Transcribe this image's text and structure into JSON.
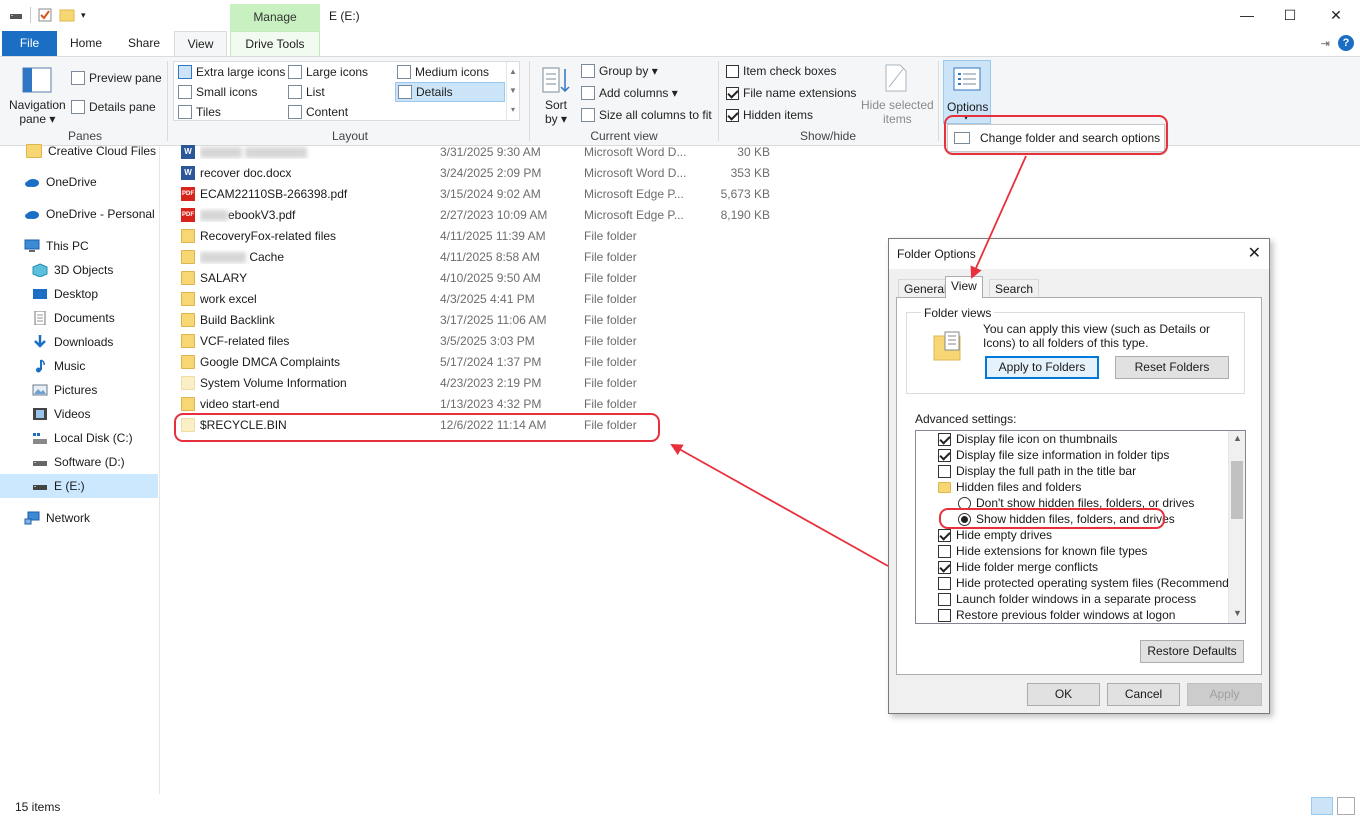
{
  "window": {
    "title": "E (E:)",
    "contextual_tab": "Manage",
    "minimize": "—",
    "maximize": "☐",
    "close": "✕"
  },
  "tabs": {
    "file": "File",
    "home": "Home",
    "share": "Share",
    "view": "View",
    "drive_tools": "Drive Tools"
  },
  "ribbon": {
    "panes": {
      "label": "Panes",
      "navigation_pane_line1": "Navigation",
      "navigation_pane_line2": "pane ▾",
      "preview_pane": "Preview pane",
      "details_pane": "Details pane"
    },
    "layout": {
      "label": "Layout",
      "items": [
        "Extra large icons",
        "Large icons",
        "Medium icons",
        "Small icons",
        "List",
        "Details",
        "Tiles",
        "Content"
      ],
      "selected": "Details"
    },
    "current_view": {
      "label": "Current view",
      "sort_line1": "Sort",
      "sort_line2": "by ▾",
      "group_by": "Group by ▾",
      "add_columns": "Add columns ▾",
      "size_columns": "Size all columns to fit"
    },
    "show_hide": {
      "label": "Show/hide",
      "item_check_boxes": "Item check boxes",
      "file_name_extensions": "File name extensions",
      "hidden_items": "Hidden items",
      "hide_selected_line1": "Hide selected",
      "hide_selected_line2": "items"
    },
    "options": {
      "label": "Options",
      "menu_item": "Change folder and search options"
    }
  },
  "nav": {
    "items": [
      {
        "label": "Creative Cloud Files F",
        "icon": "folder-icon"
      },
      {
        "label": "OneDrive",
        "icon": "cloud-icon"
      },
      {
        "label": "OneDrive - Personal",
        "icon": "cloud-icon"
      },
      {
        "label": "This PC",
        "icon": "computer-icon"
      },
      {
        "label": "3D Objects",
        "icon": "cube-icon"
      },
      {
        "label": "Desktop",
        "icon": "desktop-icon"
      },
      {
        "label": "Documents",
        "icon": "document-icon"
      },
      {
        "label": "Downloads",
        "icon": "download-icon"
      },
      {
        "label": "Music",
        "icon": "music-icon"
      },
      {
        "label": "Pictures",
        "icon": "picture-icon"
      },
      {
        "label": "Videos",
        "icon": "video-icon"
      },
      {
        "label": "Local Disk (C:)",
        "icon": "drive-icon"
      },
      {
        "label": "Software (D:)",
        "icon": "drive-icon"
      },
      {
        "label": "E (E:)",
        "icon": "drive-icon"
      },
      {
        "label": "Network",
        "icon": "network-icon"
      }
    ]
  },
  "files": [
    {
      "name": "",
      "date": "3/31/2025 9:30 AM",
      "type": "Microsoft Word D...",
      "size": "30 KB",
      "icon": "word-icon"
    },
    {
      "name": "recover doc.docx",
      "date": "3/24/2025 2:09 PM",
      "type": "Microsoft Word D...",
      "size": "353 KB",
      "icon": "word-icon"
    },
    {
      "name": "ECAM22110SB-266398.pdf",
      "date": "3/15/2024 9:02 AM",
      "type": "Microsoft Edge P...",
      "size": "5,673 KB",
      "icon": "pdf-icon"
    },
    {
      "name": "ebookV3.pdf",
      "date": "2/27/2023 10:09 AM",
      "type": "Microsoft Edge P...",
      "size": "8,190 KB",
      "icon": "pdf-icon"
    },
    {
      "name": "RecoveryFox-related files",
      "date": "4/11/2025 11:39 AM",
      "type": "File folder",
      "size": "",
      "icon": "folder-icon"
    },
    {
      "name": "Cache",
      "date": "4/11/2025 8:58 AM",
      "type": "File folder",
      "size": "",
      "icon": "folder-icon"
    },
    {
      "name": "SALARY",
      "date": "4/10/2025 9:50 AM",
      "type": "File folder",
      "size": "",
      "icon": "folder-icon"
    },
    {
      "name": "work excel",
      "date": "4/3/2025 4:41 PM",
      "type": "File folder",
      "size": "",
      "icon": "folder-icon"
    },
    {
      "name": "Build Backlink",
      "date": "3/17/2025 11:06 AM",
      "type": "File folder",
      "size": "",
      "icon": "folder-icon"
    },
    {
      "name": "VCF-related files",
      "date": "3/5/2025 3:03 PM",
      "type": "File folder",
      "size": "",
      "icon": "folder-icon"
    },
    {
      "name": "Google DMCA Complaints",
      "date": "5/17/2024 1:37 PM",
      "type": "File folder",
      "size": "",
      "icon": "folder-icon"
    },
    {
      "name": "System Volume Information",
      "date": "4/23/2023 2:19 PM",
      "type": "File folder",
      "size": "",
      "icon": "folder-icon"
    },
    {
      "name": "video start-end",
      "date": "1/13/2023 4:32 PM",
      "type": "File folder",
      "size": "",
      "icon": "folder-icon"
    },
    {
      "name": "$RECYCLE.BIN",
      "date": "12/6/2022 11:14 AM",
      "type": "File folder",
      "size": "",
      "icon": "folder-icon"
    }
  ],
  "status": {
    "items_count": "15 items"
  },
  "dialog": {
    "title": "Folder Options",
    "tabs": [
      "General",
      "View",
      "Search"
    ],
    "active_tab": "View",
    "folder_views": {
      "legend": "Folder views",
      "description": "You can apply this view (such as Details or Icons) to all folders of this type.",
      "apply_button": "Apply to Folders",
      "reset_button": "Reset Folders"
    },
    "advanced_label": "Advanced settings:",
    "advanced_items": [
      {
        "label": "Display file icon on thumbnails",
        "kind": "checkbox",
        "checked": true
      },
      {
        "label": "Display file size information in folder tips",
        "kind": "checkbox",
        "checked": true
      },
      {
        "label": "Display the full path in the title bar",
        "kind": "checkbox",
        "checked": false
      },
      {
        "label": "Hidden files and folders",
        "kind": "folder",
        "checked": false
      },
      {
        "label": "Don't show hidden files, folders, or drives",
        "kind": "radio",
        "checked": false
      },
      {
        "label": "Show hidden files, folders, and drives",
        "kind": "radio",
        "checked": true
      },
      {
        "label": "Hide empty drives",
        "kind": "checkbox",
        "checked": true
      },
      {
        "label": "Hide extensions for known file types",
        "kind": "checkbox",
        "checked": false
      },
      {
        "label": "Hide folder merge conflicts",
        "kind": "checkbox",
        "checked": true
      },
      {
        "label": "Hide protected operating system files (Recommended)",
        "kind": "checkbox",
        "checked": false
      },
      {
        "label": "Launch folder windows in a separate process",
        "kind": "checkbox",
        "checked": false
      },
      {
        "label": "Restore previous folder windows at logon",
        "kind": "checkbox",
        "checked": false
      }
    ],
    "restore_defaults": "Restore Defaults",
    "ok": "OK",
    "cancel": "Cancel",
    "apply": "Apply"
  },
  "colors": {
    "accent": "#1a6fc4",
    "annotation": "#e8303c",
    "manage_tab": "#c9f0c0",
    "selection": "#cce8ff"
  }
}
